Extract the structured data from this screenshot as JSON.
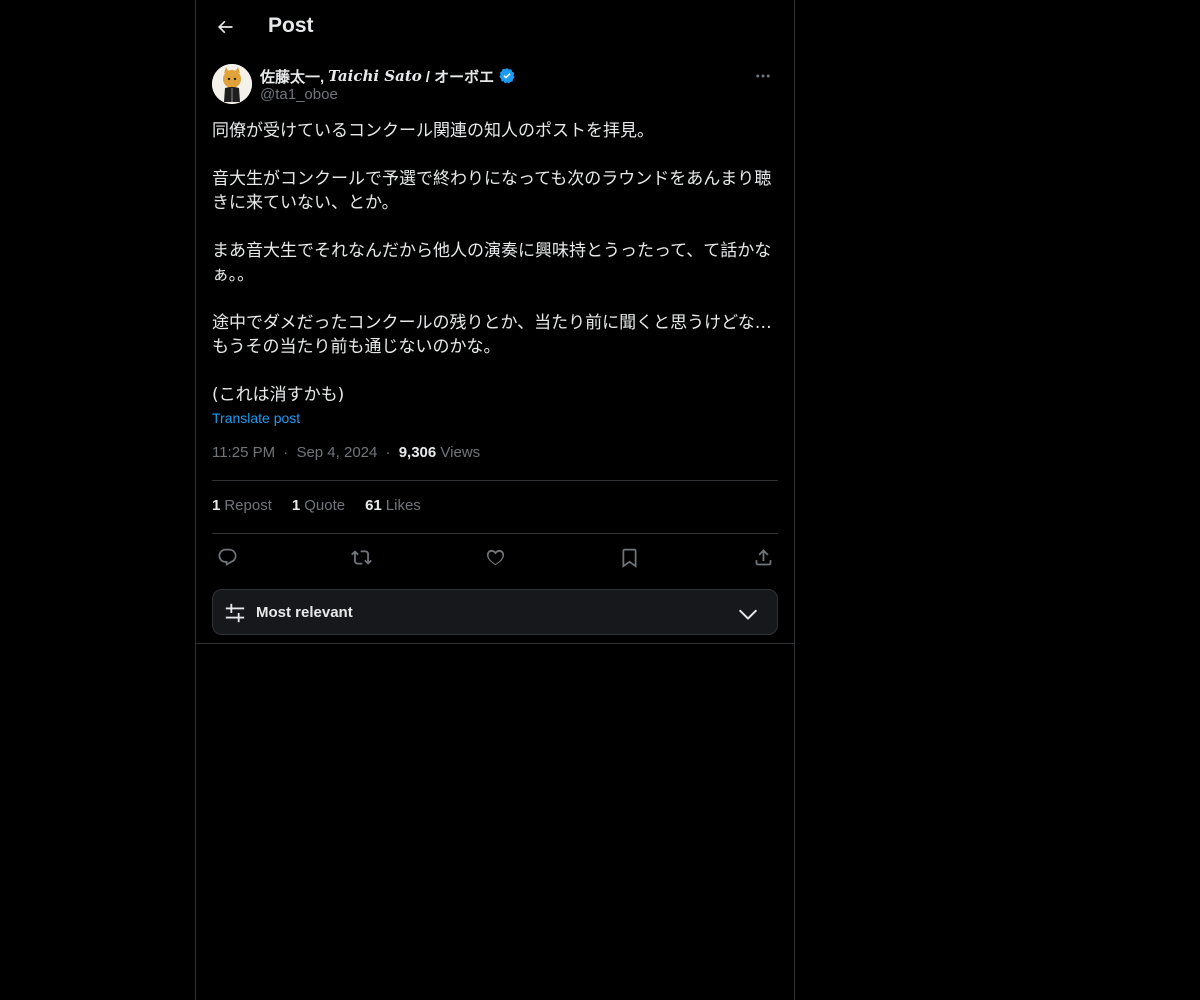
{
  "header": {
    "title": "Post"
  },
  "author": {
    "name_prefix": "佐藤太一,",
    "name_italic": "Taichi Sato",
    "name_suffix": "/ オーボエ",
    "handle": "@ta1_oboe"
  },
  "post": {
    "paragraphs": [
      "同僚が受けているコンクール関連の知人のポストを拝見。",
      "音大生がコンクールで予選で終わりになっても次のラウンドをあんまり聴きに来ていない、とか。",
      "まあ音大生でそれなんだから他人の演奏に興味持とうったって、て話かなぁ。。",
      "途中でダメだったコンクールの残りとか、当たり前に聞くと思うけどな…もうその当たり前も通じないのかな。",
      "(これは消すかも)"
    ],
    "translate_label": "Translate post"
  },
  "meta": {
    "time": "11:25 PM",
    "date": "Sep 4, 2024",
    "views_count": "9,306",
    "views_label": "Views",
    "separator": "·"
  },
  "stats": {
    "reposts_count": "1",
    "reposts_label": "Repost",
    "quotes_count": "1",
    "quotes_label": "Quote",
    "likes_count": "61",
    "likes_label": "Likes"
  },
  "actions": [
    "reply-icon",
    "repost-icon",
    "like-icon",
    "bookmark-icon",
    "share-icon"
  ],
  "sort": {
    "label": "Most relevant"
  },
  "colors": {
    "accent": "#1d9bf0",
    "secondary_text": "#71767b",
    "border": "#2f3336"
  }
}
